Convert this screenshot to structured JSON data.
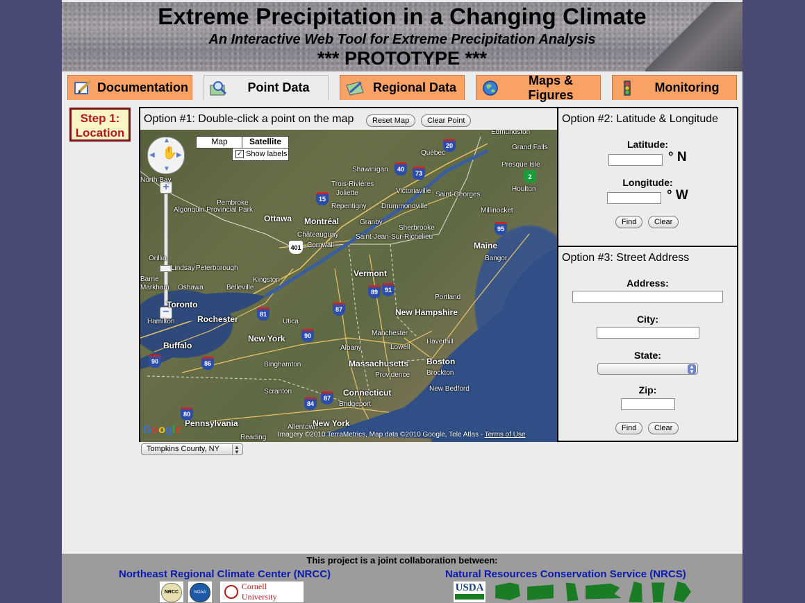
{
  "header": {
    "title": "Extreme Precipitation in a Changing Climate",
    "subtitle": "An Interactive Web Tool for Extreme Precipitation Analysis",
    "status": "*** PROTOTYPE ***"
  },
  "tabs": [
    {
      "label": "Documentation",
      "icon": "pencil-note-icon",
      "active": false
    },
    {
      "label": "Point Data",
      "icon": "magnifier-map-icon",
      "active": true
    },
    {
      "label": "Regional Data",
      "icon": "map-pencil-icon",
      "active": false
    },
    {
      "label": "Maps & Figures",
      "icon": "globe-icon",
      "active": false
    },
    {
      "label": "Monitoring",
      "icon": "traffic-light-icon",
      "active": false
    }
  ],
  "step": {
    "line1": "Step 1:",
    "line2": "Location"
  },
  "option1": {
    "title": "Option #1: Double-click a point on the map",
    "reset_label": "Reset Map",
    "clear_label": "Clear Point"
  },
  "map": {
    "type_map": "Map",
    "type_satellite": "Satellite",
    "show_labels": "Show labels",
    "attribution": "Imagery ©2010 TerraMetrics, Map data ©2010 Google, Tele Atlas - ",
    "terms": "Terms of Use",
    "google": "Google",
    "county_select": "Tompkins County, NY",
    "labels": [
      "Edmundston",
      "Grand Falls",
      "Québec",
      "Presque Isle",
      "Shawinigan",
      "Houlton",
      "Trois-Rivières",
      "Joliette",
      "Victoriaville",
      "Saint-Georges",
      "Millinocket",
      "Pembroke",
      "Repentigny",
      "Drummondville",
      "North Bay",
      "Algonquin Provincial Park",
      "Ottawa",
      "Montréal",
      "Granby",
      "Sherbrooke",
      "Châteauguay",
      "Saint-Jean-Sur-Richelieu",
      "Cornwall",
      "Maine",
      "Bangor",
      "Orillia",
      "Peterborough",
      "Kingston",
      "Vermont",
      "Barrie",
      "Lindsay",
      "Belleville",
      "Portland",
      "Markham",
      "Oshawa",
      "Toronto",
      "New Hampshire",
      "Hamilton",
      "Rochester",
      "Utica",
      "Manchester",
      "Haverhill",
      "New York",
      "Buffalo",
      "Albany",
      "Lowell",
      "Massachusetts",
      "Boston",
      "Binghamton",
      "Brockton",
      "Providence",
      "Connecticut",
      "New Bedford",
      "Scranton",
      "Bridgeport",
      "Pennsylvania",
      "New York",
      "Allentown",
      "Reading"
    ],
    "shields": [
      "20",
      "40",
      "73",
      "15",
      "95",
      "401",
      "89",
      "91",
      "87",
      "81",
      "90",
      "86",
      "90",
      "84",
      "87",
      "80",
      "2"
    ]
  },
  "option2": {
    "title": "Option #2: Latitude & Longitude",
    "lat_label": "Latitude:",
    "lat_unit": "° N",
    "lon_label": "Longitude:",
    "lon_unit": "° W",
    "find_label": "Find",
    "clear_label": "Clear"
  },
  "option3": {
    "title": "Option #3: Street Address",
    "address_label": "Address:",
    "city_label": "City:",
    "state_label": "State:",
    "state_value": "",
    "zip_label": "Zip:",
    "find_label": "Find",
    "clear_label": "Clear"
  },
  "footer": {
    "title": "This project is a joint collaboration between:",
    "nrcc_link": "Northeast Regional Climate Center (NRCC)",
    "nrcs_link": "Natural Resources Conservation Service (NRCS)",
    "logos_left": [
      "NRCC",
      "NOAA",
      "Cornell University"
    ],
    "logos_right": [
      "USDA"
    ]
  },
  "colors": {
    "tab": "#f9a266",
    "background": "#4a4a77",
    "step_text": "#b4191d",
    "link": "#0c1ab3"
  }
}
